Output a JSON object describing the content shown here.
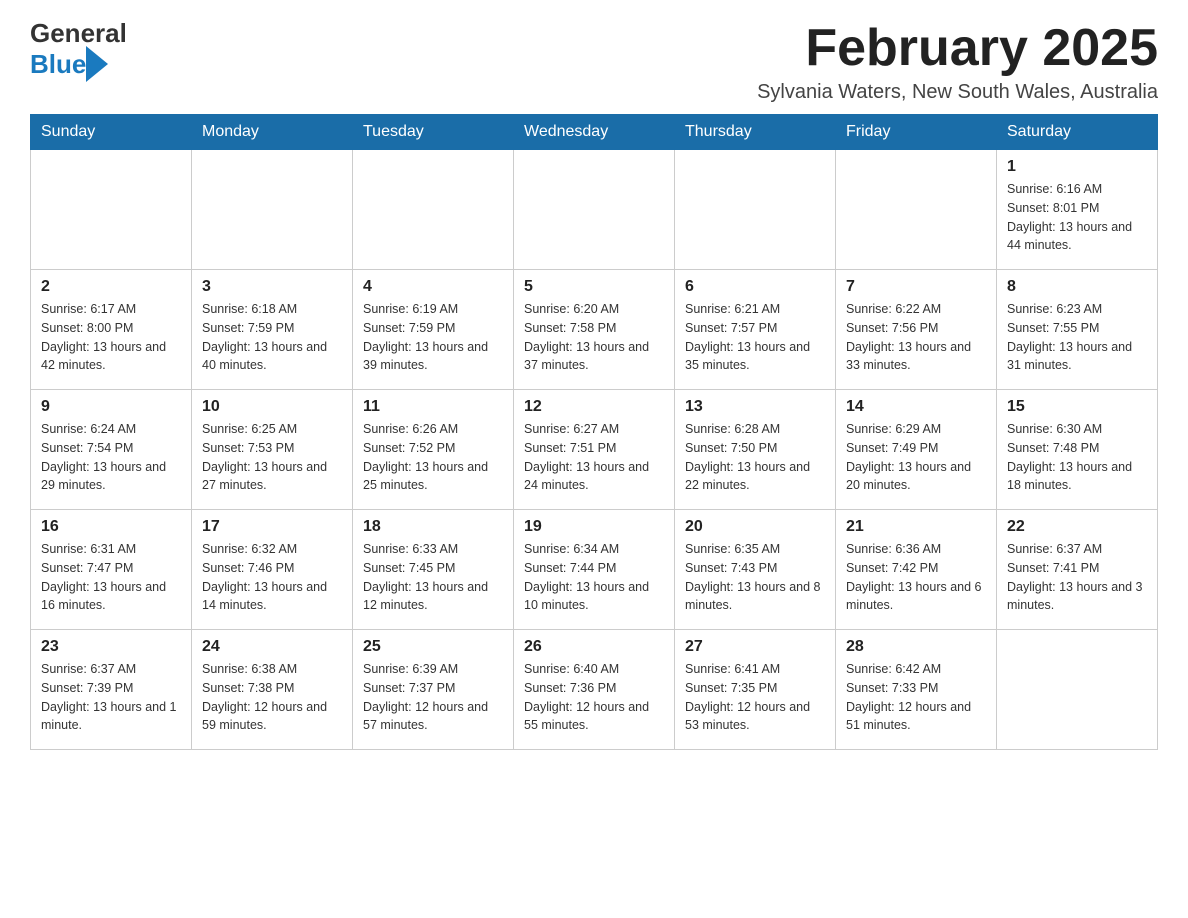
{
  "logo": {
    "general": "General",
    "blue": "Blue"
  },
  "title": {
    "month_year": "February 2025",
    "location": "Sylvania Waters, New South Wales, Australia"
  },
  "days_of_week": [
    "Sunday",
    "Monday",
    "Tuesday",
    "Wednesday",
    "Thursday",
    "Friday",
    "Saturday"
  ],
  "weeks": [
    {
      "days": [
        {
          "number": "",
          "info": ""
        },
        {
          "number": "",
          "info": ""
        },
        {
          "number": "",
          "info": ""
        },
        {
          "number": "",
          "info": ""
        },
        {
          "number": "",
          "info": ""
        },
        {
          "number": "",
          "info": ""
        },
        {
          "number": "1",
          "info": "Sunrise: 6:16 AM\nSunset: 8:01 PM\nDaylight: 13 hours and 44 minutes."
        }
      ]
    },
    {
      "days": [
        {
          "number": "2",
          "info": "Sunrise: 6:17 AM\nSunset: 8:00 PM\nDaylight: 13 hours and 42 minutes."
        },
        {
          "number": "3",
          "info": "Sunrise: 6:18 AM\nSunset: 7:59 PM\nDaylight: 13 hours and 40 minutes."
        },
        {
          "number": "4",
          "info": "Sunrise: 6:19 AM\nSunset: 7:59 PM\nDaylight: 13 hours and 39 minutes."
        },
        {
          "number": "5",
          "info": "Sunrise: 6:20 AM\nSunset: 7:58 PM\nDaylight: 13 hours and 37 minutes."
        },
        {
          "number": "6",
          "info": "Sunrise: 6:21 AM\nSunset: 7:57 PM\nDaylight: 13 hours and 35 minutes."
        },
        {
          "number": "7",
          "info": "Sunrise: 6:22 AM\nSunset: 7:56 PM\nDaylight: 13 hours and 33 minutes."
        },
        {
          "number": "8",
          "info": "Sunrise: 6:23 AM\nSunset: 7:55 PM\nDaylight: 13 hours and 31 minutes."
        }
      ]
    },
    {
      "days": [
        {
          "number": "9",
          "info": "Sunrise: 6:24 AM\nSunset: 7:54 PM\nDaylight: 13 hours and 29 minutes."
        },
        {
          "number": "10",
          "info": "Sunrise: 6:25 AM\nSunset: 7:53 PM\nDaylight: 13 hours and 27 minutes."
        },
        {
          "number": "11",
          "info": "Sunrise: 6:26 AM\nSunset: 7:52 PM\nDaylight: 13 hours and 25 minutes."
        },
        {
          "number": "12",
          "info": "Sunrise: 6:27 AM\nSunset: 7:51 PM\nDaylight: 13 hours and 24 minutes."
        },
        {
          "number": "13",
          "info": "Sunrise: 6:28 AM\nSunset: 7:50 PM\nDaylight: 13 hours and 22 minutes."
        },
        {
          "number": "14",
          "info": "Sunrise: 6:29 AM\nSunset: 7:49 PM\nDaylight: 13 hours and 20 minutes."
        },
        {
          "number": "15",
          "info": "Sunrise: 6:30 AM\nSunset: 7:48 PM\nDaylight: 13 hours and 18 minutes."
        }
      ]
    },
    {
      "days": [
        {
          "number": "16",
          "info": "Sunrise: 6:31 AM\nSunset: 7:47 PM\nDaylight: 13 hours and 16 minutes."
        },
        {
          "number": "17",
          "info": "Sunrise: 6:32 AM\nSunset: 7:46 PM\nDaylight: 13 hours and 14 minutes."
        },
        {
          "number": "18",
          "info": "Sunrise: 6:33 AM\nSunset: 7:45 PM\nDaylight: 13 hours and 12 minutes."
        },
        {
          "number": "19",
          "info": "Sunrise: 6:34 AM\nSunset: 7:44 PM\nDaylight: 13 hours and 10 minutes."
        },
        {
          "number": "20",
          "info": "Sunrise: 6:35 AM\nSunset: 7:43 PM\nDaylight: 13 hours and 8 minutes."
        },
        {
          "number": "21",
          "info": "Sunrise: 6:36 AM\nSunset: 7:42 PM\nDaylight: 13 hours and 6 minutes."
        },
        {
          "number": "22",
          "info": "Sunrise: 6:37 AM\nSunset: 7:41 PM\nDaylight: 13 hours and 3 minutes."
        }
      ]
    },
    {
      "days": [
        {
          "number": "23",
          "info": "Sunrise: 6:37 AM\nSunset: 7:39 PM\nDaylight: 13 hours and 1 minute."
        },
        {
          "number": "24",
          "info": "Sunrise: 6:38 AM\nSunset: 7:38 PM\nDaylight: 12 hours and 59 minutes."
        },
        {
          "number": "25",
          "info": "Sunrise: 6:39 AM\nSunset: 7:37 PM\nDaylight: 12 hours and 57 minutes."
        },
        {
          "number": "26",
          "info": "Sunrise: 6:40 AM\nSunset: 7:36 PM\nDaylight: 12 hours and 55 minutes."
        },
        {
          "number": "27",
          "info": "Sunrise: 6:41 AM\nSunset: 7:35 PM\nDaylight: 12 hours and 53 minutes."
        },
        {
          "number": "28",
          "info": "Sunrise: 6:42 AM\nSunset: 7:33 PM\nDaylight: 12 hours and 51 minutes."
        },
        {
          "number": "",
          "info": ""
        }
      ]
    }
  ]
}
